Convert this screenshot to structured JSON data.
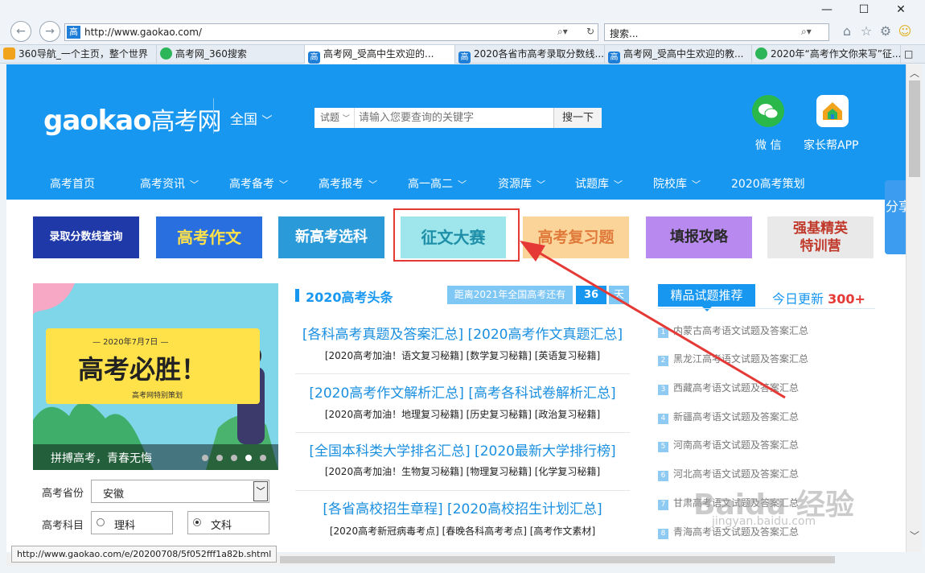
{
  "window": {
    "minimize": "—",
    "maximize": "☐",
    "close": "✕"
  },
  "browser": {
    "address_fav": "高",
    "address": "http://www.gaokao.com/",
    "search_placeholder": "搜索...",
    "tabs": [
      {
        "label": "360导航_一个主页，整个世界",
        "color": "#f2a31c",
        "icon": "360"
      },
      {
        "label": "高考网_360搜索",
        "color": "#2db559",
        "icon": "360搜"
      },
      {
        "label": "高考网_受高中生欢迎的...",
        "color": "#1f7fd8",
        "icon": "高",
        "active": true
      },
      {
        "label": "2020各省市高考录取分数线...",
        "color": "#1f7fd8",
        "icon": "高"
      },
      {
        "label": "高考网_受高中生欢迎的教...",
        "color": "#1f7fd8",
        "icon": "高"
      },
      {
        "label": "2020年“高考作文你来写”征...",
        "color": "#2db559",
        "icon": "征"
      }
    ]
  },
  "header": {
    "logo_en": "gaokao",
    "logo_cn": "高考网",
    "region": "全国",
    "search_category": "试题",
    "search_placeholder": "请输入您要查询的关键字",
    "search_button": "搜一下",
    "wechat_label": "微 信",
    "app_label": "家长帮APP"
  },
  "nav": [
    {
      "label": "高考首页",
      "chev": false
    },
    {
      "label": "高考资讯",
      "chev": true
    },
    {
      "label": "高考备考",
      "chev": true
    },
    {
      "label": "高考报考",
      "chev": true
    },
    {
      "label": "高一高二",
      "chev": true
    },
    {
      "label": "资源库",
      "chev": true
    },
    {
      "label": "试题库",
      "chev": true
    },
    {
      "label": "院校库",
      "chev": true
    },
    {
      "label": "2020高考策划",
      "chev": false
    }
  ],
  "banners": [
    {
      "label": "录取分数线查询",
      "bg": "#1f3aa8",
      "fg": "#ffffff"
    },
    {
      "label": "高考作文",
      "bg": "#2a6fe0",
      "fg": "#ffe24a"
    },
    {
      "label": "新高考选科",
      "bg": "#2a9ad8",
      "fg": "#ffffff"
    },
    {
      "label": "征文大赛",
      "bg": "#9ee6ec",
      "fg": "#1f8fa8"
    },
    {
      "label": "高考复习题",
      "bg": "#fbd49a",
      "fg": "#e07a3a"
    },
    {
      "label": "填报攻略",
      "bg": "#b88af0",
      "fg": "#2a2a2a"
    },
    {
      "label": "强基精英特训营",
      "bg": "#e9e9e9",
      "fg": "#c0392b"
    }
  ],
  "slide": {
    "date": "— 2020年7月7日 —",
    "headline": "高考必胜！",
    "sub": "高考网特别策划",
    "caption": "拼搏高考，青春无悔",
    "dots": 5,
    "active_dot": 4
  },
  "form": {
    "province_label": "高考省份",
    "province_value": "安徽",
    "subject_label": "高考科目",
    "option1": "理科",
    "option2": "文科"
  },
  "headlines": {
    "title": "2020高考头条",
    "countdown_label": "距离2021年全国高考还有",
    "countdown_num": "36",
    "countdown_unit": "天",
    "items": [
      {
        "main": "[各科高考真题及答案汇总] [2020高考作文真题汇总]",
        "sub": "[2020高考加油！语文复习秘籍] [数学复习秘籍] [英语复习秘籍]"
      },
      {
        "main": "[2020高考作文解析汇总] [高考各科试卷解析汇总]",
        "sub": "[2020高考加油！地理复习秘籍] [历史复习秘籍] [政治复习秘籍]"
      },
      {
        "main": "[全国本科类大学排名汇总] [2020最新大学排行榜]",
        "sub": "[2020高考加油！生物复习秘籍] [物理复习秘籍] [化学复习秘籍]"
      },
      {
        "main": "[各省高校招生章程] [2020高校招生计划汇总]",
        "sub": "[2020高考新冠病毒考点] [春晚各科高考考点] [高考作文素材]"
      }
    ]
  },
  "recs": {
    "title": "精品试题推荐",
    "update_prefix": "今日更新",
    "update_count": "300+",
    "items": [
      "内蒙古高考语文试题及答案汇总",
      "黑龙江高考语文试题及答案汇总",
      "西藏高考语文试题及答案汇总",
      "新疆高考语文试题及答案汇总",
      "河南高考语文试题及答案汇总",
      "河北高考语文试题及答案汇总",
      "甘肃高考语文试题及答案汇总",
      "青海高考语文试题及答案汇总"
    ]
  },
  "share": "分享",
  "status_url": "http://www.gaokao.com/e/20200708/5f052fff1a82b.shtml",
  "watermark": {
    "main": "Baidu 经验",
    "sub": "jingyan.baidu.com"
  }
}
